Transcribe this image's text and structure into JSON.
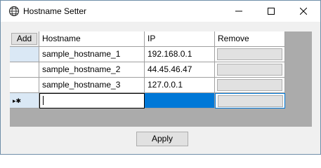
{
  "window": {
    "title": "Hostname Setter"
  },
  "grid": {
    "add_label": "Add",
    "columns": [
      "Hostname",
      "IP",
      "Remove"
    ],
    "rows": [
      {
        "hostname": "sample_hostname_1",
        "ip": "192.168.0.1"
      },
      {
        "hostname": "sample_hostname_2",
        "ip": "44.45.46.47"
      },
      {
        "hostname": "sample_hostname_3",
        "ip": "127.0.0.1"
      }
    ],
    "new_row_marker": "▸✱",
    "new_row": {
      "hostname": "",
      "ip": ""
    }
  },
  "apply_label": "Apply",
  "colors": {
    "selection": "#0078d7",
    "grid_bg": "#ababab",
    "row_selected": "#dae8f5"
  },
  "icons": [
    "globe-app-icon",
    "minimize-icon",
    "maximize-icon",
    "close-icon"
  ]
}
